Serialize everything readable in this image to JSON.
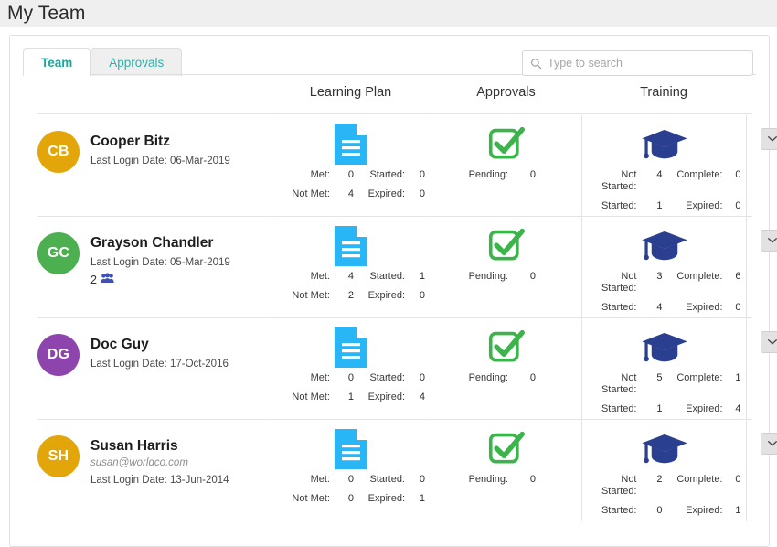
{
  "page": {
    "title": "My Team"
  },
  "tabs": [
    {
      "label": "Team",
      "active": true
    },
    {
      "label": "Approvals",
      "active": false
    }
  ],
  "search": {
    "placeholder": "Type to search",
    "value": ""
  },
  "columns": {
    "learning_plan": "Learning Plan",
    "approvals": "Approvals",
    "training": "Training"
  },
  "labels": {
    "met": "Met:",
    "not_met": "Not Met:",
    "started": "Started:",
    "expired": "Expired:",
    "pending": "Pending:",
    "not_started": "Not Started:",
    "complete": "Complete:",
    "last_login_prefix": "Last Login Date:"
  },
  "colors": {
    "accent_teal": "#20b2aa",
    "learning_plan_icon": "#29b6f6",
    "approvals_icon": "#3cb44b",
    "training_icon": "#2a3f8f",
    "group_icon": "#3f51b5",
    "page_header_bg": "#efefef"
  },
  "icons": {
    "search": "search-icon",
    "learning_plan": "document-icon",
    "approvals": "checkbox-check-icon",
    "training": "graduation-cap-icon",
    "group": "people-group-icon",
    "expand": "chevron-down-icon"
  },
  "rows": [
    {
      "initials": "CB",
      "avatar_color": "#e2a50a",
      "name": "Cooper Bitz",
      "email": "",
      "last_login": "Last Login Date: 06-Mar-2019",
      "group_count": "",
      "learning_plan": {
        "met": "0",
        "not_met": "4",
        "started": "0",
        "expired": "0"
      },
      "approvals": {
        "pending": "0"
      },
      "training": {
        "not_started": "4",
        "started": "1",
        "complete": "0",
        "expired": "0"
      }
    },
    {
      "initials": "GC",
      "avatar_color": "#4caf50",
      "name": "Grayson Chandler",
      "email": "",
      "last_login": "Last Login Date: 05-Mar-2019",
      "group_count": "2",
      "learning_plan": {
        "met": "4",
        "not_met": "2",
        "started": "1",
        "expired": "0"
      },
      "approvals": {
        "pending": "0"
      },
      "training": {
        "not_started": "3",
        "started": "4",
        "complete": "6",
        "expired": "0"
      }
    },
    {
      "initials": "DG",
      "avatar_color": "#8e44ad",
      "name": "Doc Guy",
      "email": "",
      "last_login": "Last Login Date: 17-Oct-2016",
      "group_count": "",
      "learning_plan": {
        "met": "0",
        "not_met": "1",
        "started": "0",
        "expired": "4"
      },
      "approvals": {
        "pending": "0"
      },
      "training": {
        "not_started": "5",
        "started": "1",
        "complete": "1",
        "expired": "4"
      }
    },
    {
      "initials": "SH",
      "avatar_color": "#e2a50a",
      "name": "Susan Harris",
      "email": "susan@worldco.com",
      "last_login": "Last Login Date: 13-Jun-2014",
      "group_count": "",
      "learning_plan": {
        "met": "0",
        "not_met": "0",
        "started": "0",
        "expired": "1"
      },
      "approvals": {
        "pending": "0"
      },
      "training": {
        "not_started": "2",
        "started": "0",
        "complete": "0",
        "expired": "1"
      }
    }
  ]
}
